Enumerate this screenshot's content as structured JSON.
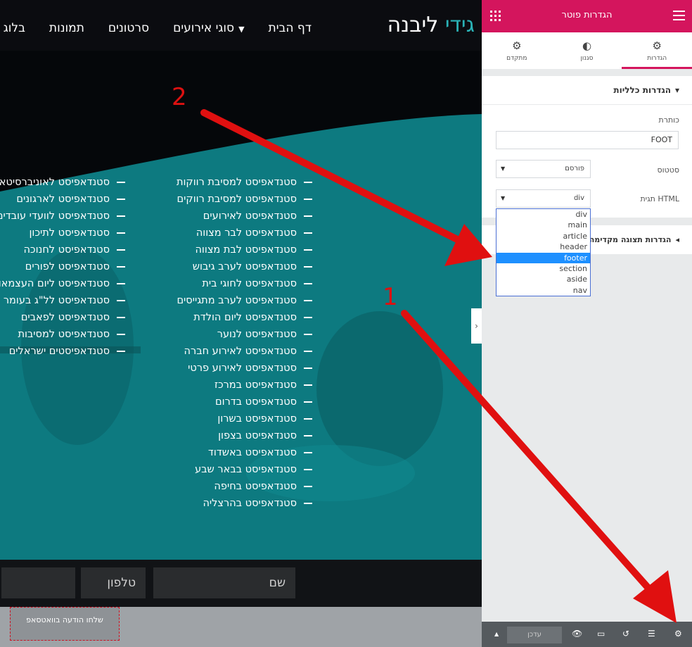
{
  "site": {
    "logo_part1": "גידי",
    "logo_part2": "ליבנה",
    "nav": [
      "דף הבית",
      "סוגי אירועים",
      "סרטונים",
      "תמונות",
      "בלוג"
    ],
    "column1": [
      "סטנדאפיסט למסיבת רווקות",
      "סטנדאפיסט למסיבת רווקים",
      "סטנדאפיסט לאירועים",
      "סטנדאפיסט לבר מצווה",
      "סטנדאפיסט לבת מצווה",
      "סטנדאפיסט לערב גיבוש",
      "סטנדאפיסט לחוגי בית",
      "סטנדאפיסט לערב מתגייסים",
      "סטנדאפיסט ליום הולדת",
      "סטנדאפיסט לנוער",
      "סטנדאפיסט לאירוע חברה",
      "סטנדאפיסט לאירוע פרטי",
      "סטנדאפיסט במרכז",
      "סטנדאפיסט בדרום",
      "סטנדאפיסט בשרון",
      "סטנדאפיסט בצפון",
      "סטנדאפיסט באשדוד",
      "סטנדאפיסט בבאר שבע",
      "סטנדאפיסט בחיפה",
      "סטנדאפיסט בהרצליה"
    ],
    "column2": [
      "סטנדאפיסט לאוניברסיטאות",
      "סטנדאפיסט לארגונים",
      "סטנדאפיסט לוועדי עובדים",
      "סטנדאפיסט לתיכון",
      "סטנדאפיסט לחנוכה",
      "סטנדאפיסט לפורים",
      "סטנדאפיסט ליום העצמאות",
      "סטנדאפיסט לל\"ג בעומר",
      "סטנדאפיסט לפאבים",
      "סטנדאפיסט למסיבות",
      "סטנדאפיסטים ישראלים"
    ],
    "form": {
      "name_placeholder": "שם",
      "phone_placeholder": "טלפון"
    },
    "send_button": "שלחו הודעה בוואטסאפ"
  },
  "panel": {
    "title": "הגדרות פוטר",
    "tabs": [
      {
        "label": "הגדרות",
        "icon": "gear-icon",
        "active": true
      },
      {
        "label": "סגנון",
        "icon": "contrast-icon",
        "active": false
      },
      {
        "label": "מתקדם",
        "icon": "gear-icon",
        "active": false
      }
    ],
    "section_general": "הגדרות כלליות",
    "title_label": "כותרת",
    "title_value": "FOOT",
    "status_label": "סטטוס",
    "status_value": "פורסם",
    "html_tag_label": "תגית HTML",
    "html_tag_value": "div",
    "html_tag_options": [
      "div",
      "main",
      "article",
      "header",
      "footer",
      "section",
      "aside",
      "nav"
    ],
    "html_tag_highlighted": "footer",
    "section_display": "הגדרות תצוגה מקדימה",
    "update_button": "עדכן"
  },
  "annotations": {
    "label1": "1",
    "label2": "2",
    "arrow_color": "#e01010"
  },
  "colors": {
    "accent": "#d4155d",
    "hero_teal": "#0d7a80",
    "logo_teal": "#2ab3b7"
  }
}
